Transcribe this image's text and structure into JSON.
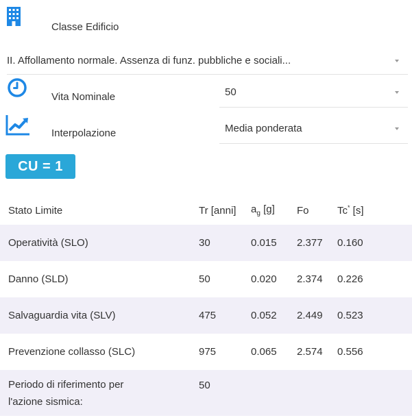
{
  "building_class": {
    "label": "Classe Edificio",
    "icon": "building-icon",
    "selected": "II. Affollamento normale. Assenza di funz. pubbliche e sociali..."
  },
  "nominal_life": {
    "label": "Vita Nominale",
    "icon": "clock-icon",
    "value": "50"
  },
  "interpolation": {
    "label": "Interpolazione",
    "icon": "chart-trend-icon",
    "value": "Media ponderata"
  },
  "cu_badge": "CU = 1",
  "table": {
    "headers": {
      "state": "Stato Limite",
      "tr": "Tr [anni]",
      "ag_main": "a",
      "ag_sub": "g",
      "ag_unit": " [g]",
      "fo": "Fo",
      "tc_main": "Tc",
      "tc_sup": "*",
      "tc_unit": " [s]"
    },
    "rows": [
      {
        "state": "Operatività (SLO)",
        "tr": "30",
        "ag": "0.015",
        "fo": "2.377",
        "tc": "0.160"
      },
      {
        "state": "Danno (SLD)",
        "tr": "50",
        "ag": "0.020",
        "fo": "2.374",
        "tc": "0.226"
      },
      {
        "state": "Salvaguardia vita (SLV)",
        "tr": "475",
        "ag": "0.052",
        "fo": "2.449",
        "tc": "0.523"
      },
      {
        "state": "Prevenzione collasso (SLC)",
        "tr": "975",
        "ag": "0.065",
        "fo": "2.574",
        "tc": "0.556"
      }
    ],
    "reference_period": {
      "label": "Periodo di riferimento per l'azione sismica:",
      "value": "50"
    }
  },
  "colors": {
    "accent": "#2aa7d8",
    "icon_blue": "#1e88e5",
    "row_shade": "#f1eff8"
  }
}
